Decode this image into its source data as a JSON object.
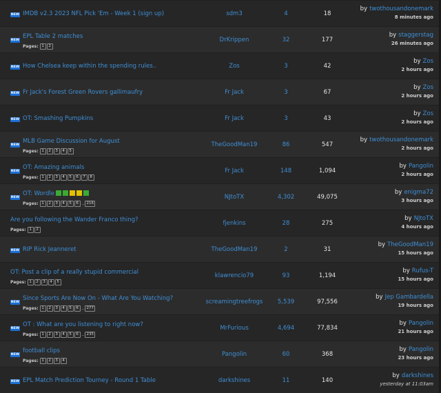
{
  "new_badge": "NEW",
  "pages_label": "Pages:",
  "by_label": "by",
  "topics": [
    {
      "title": "IMDB v2.3 2023 NFL Pick 'Em - Week 1 (sign up)",
      "new": true,
      "pages": [],
      "squares": [],
      "author": "sdm3",
      "replies": "4",
      "views": "18",
      "last_user": "twothousandonemark",
      "last_time": "8 minutes ago"
    },
    {
      "title": "EPL Table 2 matches",
      "new": true,
      "pages": [
        "1",
        "2"
      ],
      "squares": [],
      "author": "DrKrippen",
      "replies": "32",
      "views": "177",
      "last_user": "staggerstag",
      "last_time": "26 minutes ago"
    },
    {
      "title": "How Chelsea keep within the spending rules..",
      "new": true,
      "pages": [],
      "squares": [],
      "author": "Zos",
      "replies": "3",
      "views": "42",
      "last_user": "Zos",
      "last_time": "2 hours ago"
    },
    {
      "title": "Fr Jack's Forest Green Rovers gallimaufry",
      "new": true,
      "pages": [],
      "squares": [],
      "author": "Fr Jack",
      "replies": "3",
      "views": "67",
      "last_user": "Zos",
      "last_time": "2 hours ago"
    },
    {
      "title": "OT: Smashing Pumpkins",
      "new": true,
      "pages": [],
      "squares": [],
      "author": "Fr Jack",
      "replies": "3",
      "views": "43",
      "last_user": "Zos",
      "last_time": "2 hours ago"
    },
    {
      "title": "MLB Game Discussion for August",
      "new": true,
      "pages": [
        "1",
        "2",
        "3",
        "4",
        "5"
      ],
      "squares": [],
      "author": "TheGoodMan19",
      "replies": "86",
      "views": "547",
      "last_user": "twothousandonemark",
      "last_time": "2 hours ago"
    },
    {
      "title": "OT: Amazing animals",
      "new": true,
      "pages": [
        "1",
        "2",
        "3",
        "4",
        "5",
        "6",
        "7",
        "8"
      ],
      "squares": [],
      "author": "Fr Jack",
      "replies": "148",
      "views": "1,094",
      "last_user": "Pangolin",
      "last_time": "2 hours ago"
    },
    {
      "title": "OT: Wordle",
      "new": true,
      "pages": [
        "1",
        "2",
        "3",
        "4",
        "5",
        "6",
        "..",
        "216"
      ],
      "squares": [
        "#3aaa35",
        "#3aaa35",
        "#e2c200",
        "#e2c200",
        "#3aaa35"
      ],
      "author": "NJtoTX",
      "replies": "4,302",
      "views": "49,075",
      "last_user": "enigma72",
      "last_time": "3 hours ago"
    },
    {
      "title": "Are you following the Wander Franco thing?",
      "new": false,
      "pages": [
        "1",
        "2"
      ],
      "squares": [],
      "author": "fjenkins",
      "replies": "28",
      "views": "275",
      "last_user": "NJtoTX",
      "last_time": "4 hours ago"
    },
    {
      "title": "RIP Rick Jeanneret",
      "new": true,
      "pages": [],
      "squares": [],
      "author": "TheGoodMan19",
      "replies": "2",
      "views": "31",
      "last_user": "TheGoodMan19",
      "last_time": "15 hours ago"
    },
    {
      "title": "OT: Post a clip of a really stupid commercial",
      "new": false,
      "pages": [
        "1",
        "2",
        "3",
        "4",
        "5"
      ],
      "squares": [],
      "author": "klawrencio79",
      "replies": "93",
      "views": "1,194",
      "last_user": "Rufus-T",
      "last_time": "15 hours ago"
    },
    {
      "title": "Since Sports Are Now On - What Are You Watching?",
      "new": true,
      "pages": [
        "1",
        "2",
        "3",
        "4",
        "5",
        "6",
        "..",
        "277"
      ],
      "squares": [],
      "author": "screamingtreefrogs",
      "replies": "5,539",
      "views": "97,556",
      "last_user": "Jep Gambardella",
      "last_time": "19 hours ago"
    },
    {
      "title": "OT : What are you listening to right now?",
      "new": true,
      "pages": [
        "1",
        "2",
        "3",
        "4",
        "5",
        "6",
        "..",
        "235"
      ],
      "squares": [],
      "author": "MrFurious",
      "replies": "4,694",
      "views": "77,834",
      "last_user": "Pangolin",
      "last_time": "21 hours ago"
    },
    {
      "title": "football clips",
      "new": true,
      "pages": [
        "1",
        "2",
        "3",
        "4"
      ],
      "squares": [],
      "author": "Pangolin",
      "replies": "60",
      "views": "368",
      "last_user": "Pangolin",
      "last_time": "23 hours ago"
    },
    {
      "title": "EPL Match Prediction Tourney - Round 1 Table",
      "new": true,
      "pages": [],
      "squares": [],
      "author": "darkshines",
      "replies": "11",
      "views": "140",
      "last_user": "darkshines",
      "last_time": "yesterday at 11:03am"
    }
  ]
}
